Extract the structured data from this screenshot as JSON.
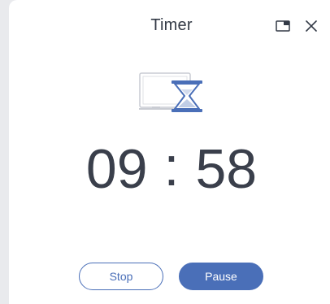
{
  "window": {
    "title": "Timer"
  },
  "icons": {
    "pip": "picture-in-picture-icon",
    "close": "close-icon",
    "illustration": "whiteboard-hourglass-illustration"
  },
  "timer": {
    "minutes": "09",
    "separator": ":",
    "seconds": "58"
  },
  "actions": {
    "stop_label": "Stop",
    "pause_label": "Pause"
  },
  "colors": {
    "accent": "#4a6fb8",
    "text": "#3a3f4b",
    "background": "#ffffff"
  }
}
